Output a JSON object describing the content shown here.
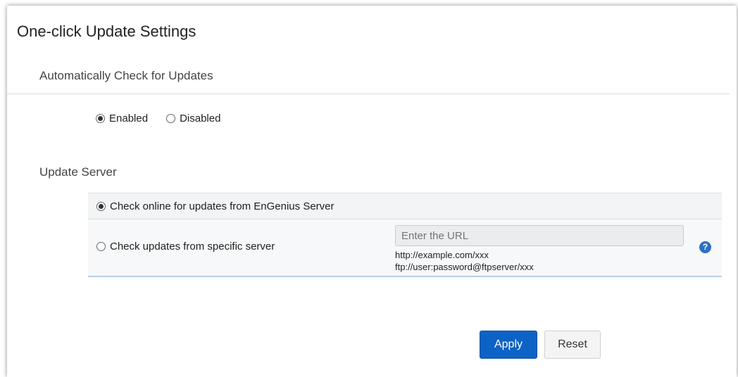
{
  "page": {
    "title": "One-click Update Settings"
  },
  "auto_check": {
    "heading": "Automatically Check for Updates",
    "options": [
      {
        "label": "Enabled",
        "selected": true
      },
      {
        "label": "Disabled",
        "selected": false
      }
    ]
  },
  "update_server": {
    "heading": "Update Server",
    "option_online": {
      "label": "Check online for updates from EnGenius Server",
      "selected": true
    },
    "option_specific": {
      "label": "Check updates from specific server",
      "selected": false
    },
    "url_input": {
      "value": "",
      "placeholder": "Enter the URL"
    },
    "hint_http": "http://example.com/xxx",
    "hint_ftp": "ftp://user:password@ftpserver/xxx",
    "help_icon": "?"
  },
  "buttons": {
    "apply": "Apply",
    "reset": "Reset"
  },
  "colors": {
    "primary": "#0d62c5",
    "help_icon": "#2f6fc4",
    "divider": "#d9dee3"
  },
  "icons": {
    "help": "help-icon"
  }
}
